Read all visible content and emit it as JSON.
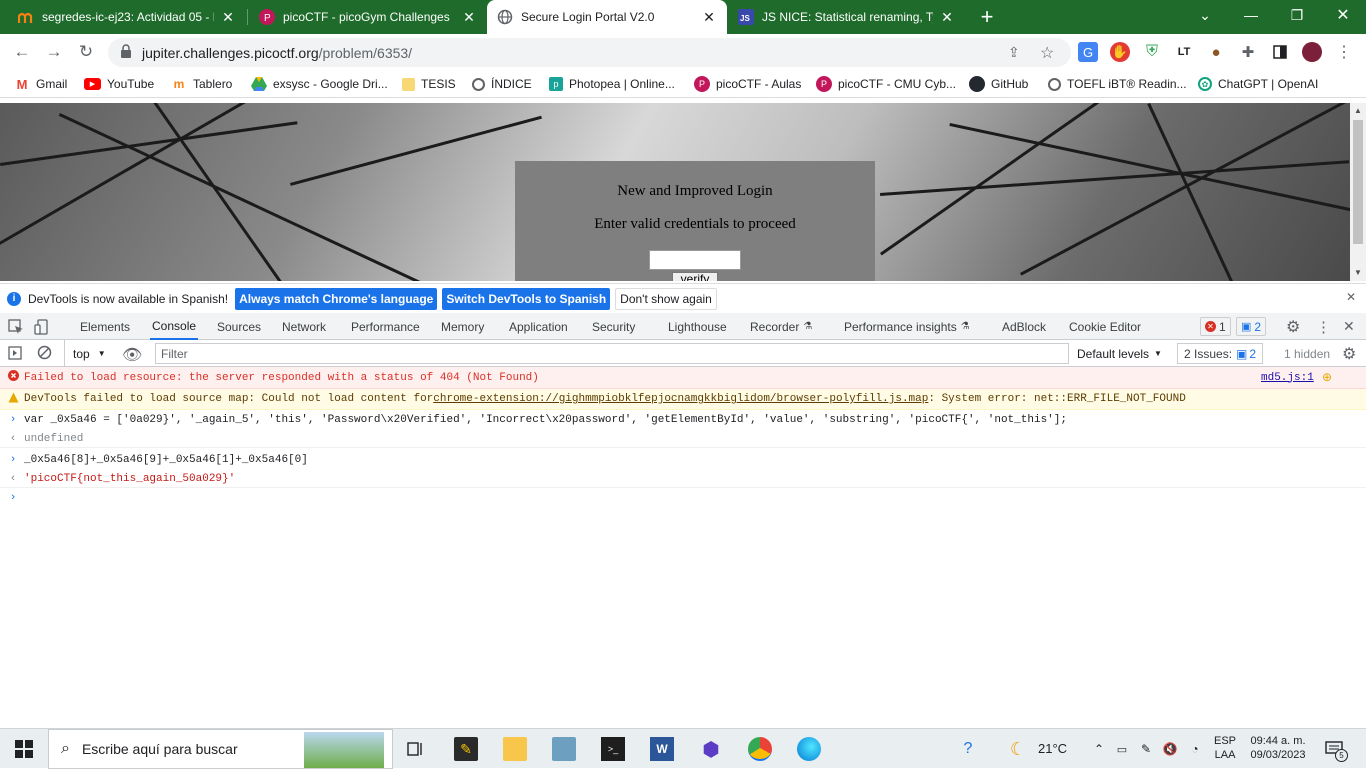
{
  "browser": {
    "tabs": [
      {
        "title": "segredes-ic-ej23: Actividad 05 - F",
        "icon": "moodle-icon",
        "active": false
      },
      {
        "title": "picoCTF - picoGym Challenges",
        "icon": "picoctf-icon",
        "active": false
      },
      {
        "title": "Secure Login Portal V2.0",
        "icon": "globe-icon",
        "active": true
      },
      {
        "title": "JS NICE: Statistical renaming, Typ",
        "icon": "jsnice-icon",
        "active": false
      }
    ],
    "new_tab": "+",
    "url_host": "jupiter.challenges.picoctf.org",
    "url_path": "/problem/6353/",
    "bookmarks": [
      {
        "label": "Gmail",
        "icon": "gmail-icon",
        "color": "#ea4335"
      },
      {
        "label": "YouTube",
        "icon": "youtube-icon",
        "color": "#ff0000"
      },
      {
        "label": "Tablero",
        "icon": "moodle-icon",
        "color": "#f98012"
      },
      {
        "label": "exsysc - Google Dri...",
        "icon": "drive-icon",
        "color": "#34a853"
      },
      {
        "label": "TESIS",
        "icon": "folder-icon",
        "color": "#f8d775"
      },
      {
        "label": "ÍNDICE",
        "icon": "globe-icon",
        "color": "#5f6368"
      },
      {
        "label": "Photopea | Online...",
        "icon": "photopea-icon",
        "color": "#18a497"
      },
      {
        "label": "picoCTF - Aulas",
        "icon": "picoctf-icon",
        "color": "#c2185b"
      },
      {
        "label": "picoCTF - CMU Cyb...",
        "icon": "picoctf-icon",
        "color": "#c2185b"
      },
      {
        "label": "GitHub",
        "icon": "github-icon",
        "color": "#24292f"
      },
      {
        "label": "TOEFL iBT® Readin...",
        "icon": "globe-icon",
        "color": "#5f6368"
      },
      {
        "label": "ChatGPT | OpenAI",
        "icon": "openai-icon",
        "color": "#10a37f"
      }
    ]
  },
  "page": {
    "heading": "New and Improved Login",
    "subheading": "Enter valid credentials to proceed",
    "verify_label": "verify"
  },
  "infobar": {
    "message": "DevTools is now available in Spanish!",
    "btn_match": "Always match Chrome's language",
    "btn_switch": "Switch DevTools to Spanish",
    "btn_dismiss": "Don't show again"
  },
  "devtools": {
    "tabs": [
      "Elements",
      "Console",
      "Sources",
      "Network",
      "Performance",
      "Memory",
      "Application",
      "Security",
      "Lighthouse",
      "Recorder",
      "Performance insights",
      "AdBlock",
      "Cookie Editor"
    ],
    "active_tab": "Console",
    "error_count": "1",
    "message_count": "2",
    "context": "top",
    "filter_placeholder": "Filter",
    "levels": "Default levels",
    "issues_label": "2 Issues:",
    "issues_count": "2",
    "hidden": "1 hidden"
  },
  "console": {
    "error_text": "Failed to load resource: the server responded with a status of 404 (Not Found)",
    "error_source": "md5.js:1",
    "warn_pre": "DevTools failed to load source map: Could not load content for ",
    "warn_link": "chrome-extension://gighmmpiobklfepjocnamgkkbiglidom/browser-polyfill.js.map",
    "warn_post": ": System error: net::ERR_FILE_NOT_FOUND",
    "cmd1": "var _0x5a46 = ['0a029}', '_again_5', 'this', 'Password\\x20Verified', 'Incorrect\\x20password', 'getElementById', 'value', 'substring', 'picoCTF{', 'not_this'];",
    "out1": "undefined",
    "cmd2": "_0x5a46[8]+_0x5a46[9]+_0x5a46[1]+_0x5a46[0]",
    "out2": "'picoCTF{not_this_again_50a029}'"
  },
  "taskbar": {
    "search_placeholder": "Escribe aquí para buscar",
    "temperature": "21°C",
    "lang_top": "ESP",
    "lang_bottom": "LAA",
    "time": "09:44 a. m.",
    "date": "09/03/2023",
    "notif_count": "5"
  },
  "colors": {
    "tabstrip": "#1e6b2b",
    "accent": "#1a73e8",
    "error": "#d93025"
  }
}
